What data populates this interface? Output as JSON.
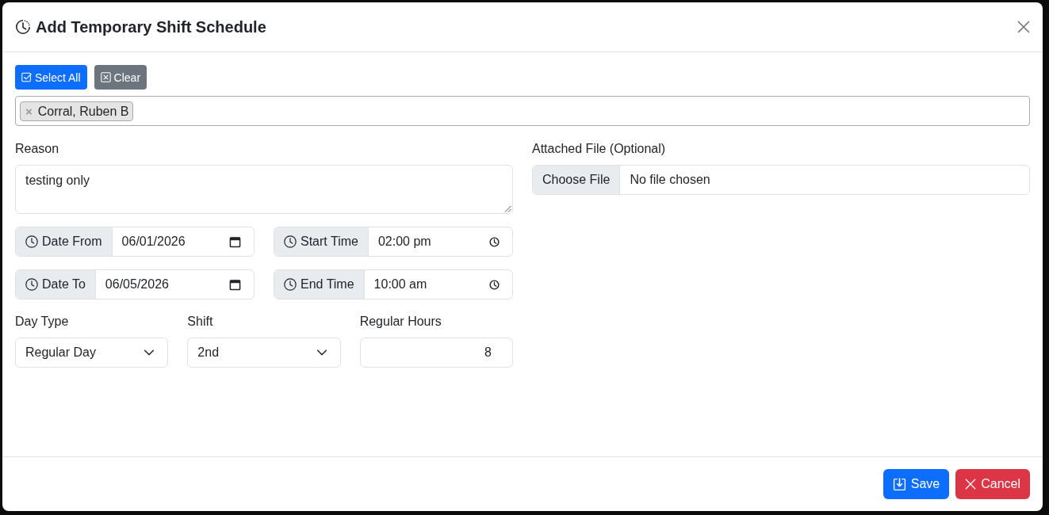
{
  "dialog": {
    "title": "Add Temporary Shift Schedule"
  },
  "selection_buttons": [
    {
      "kind": "select-all",
      "label": "Select All"
    },
    {
      "kind": "clear",
      "label": "Clear"
    }
  ],
  "selected_employees": [
    {
      "name": "Corral, Ruben B",
      "remove": "×"
    }
  ],
  "reason": {
    "label": "Reason",
    "value": "testing only"
  },
  "attachment": {
    "label": "Attached File (Optional)",
    "button": "Choose File",
    "status": "No file chosen"
  },
  "date_time_fields": [
    {
      "kind": "date",
      "label": "Date From",
      "value": "06/01/2026"
    },
    {
      "kind": "time",
      "label": "Start Time",
      "value": "02:00 pm"
    },
    {
      "kind": "date",
      "label": "Date To",
      "value": "06/05/2026"
    },
    {
      "kind": "time",
      "label": "End Time",
      "value": "10:00 am"
    }
  ],
  "schedule_fields": [
    {
      "kind": "select",
      "label": "Day Type",
      "value": "Regular Day"
    },
    {
      "kind": "select",
      "label": "Shift",
      "value": "2nd"
    },
    {
      "kind": "number",
      "label": "Regular Hours",
      "value": "8"
    }
  ],
  "footer_buttons": [
    {
      "kind": "save",
      "label": "Save"
    },
    {
      "kind": "cancel",
      "label": "Cancel"
    }
  ]
}
